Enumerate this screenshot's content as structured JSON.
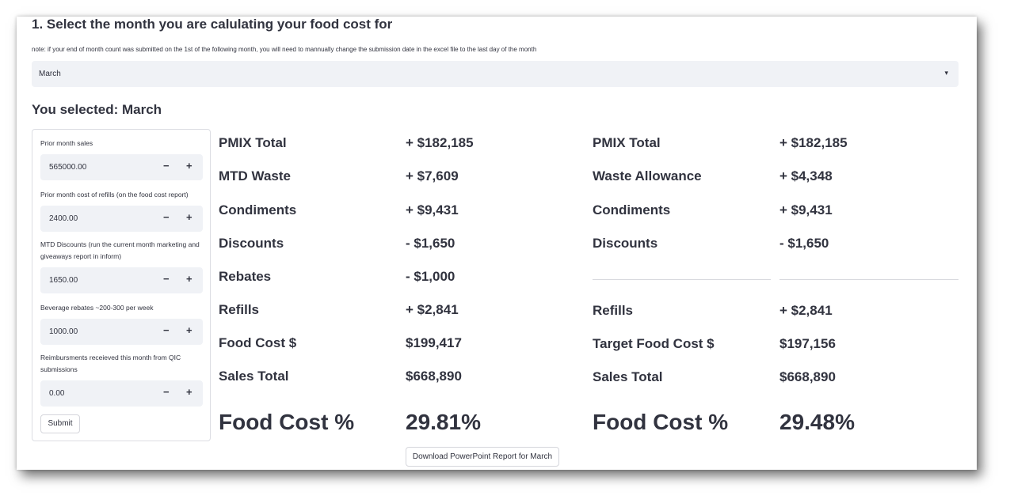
{
  "step_title": "1. Select the month you are calulating your food cost for",
  "note": "note: if your end of month count was submitted on the 1st of the following month, you will need to mannually change the submission date in the excel file to the last day of the month",
  "month_select": {
    "value": "March",
    "caret": "▾"
  },
  "selected_heading": "You selected: March",
  "form": {
    "fields": [
      {
        "label": "Prior month sales",
        "value": "565000.00"
      },
      {
        "label": "Prior month cost of refills (on the food cost report)",
        "value": "2400.00"
      },
      {
        "label": "MTD Discounts (run the current month marketing and giveaways report in inform)",
        "value": "1650.00"
      },
      {
        "label": "Beverage rebates ~200-300 per week",
        "value": "1000.00"
      },
      {
        "label": "Reimbursments receieved this month from QIC submissions",
        "value": "0.00"
      }
    ],
    "minus": "−",
    "plus": "+",
    "submit_label": "Submit"
  },
  "actual": [
    {
      "label": "PMIX Total",
      "value": "+ $182,185"
    },
    {
      "label": "MTD Waste",
      "value": "+ $7,609"
    },
    {
      "label": "Condiments",
      "value": "+ $9,431"
    },
    {
      "label": "Discounts",
      "value": "- $1,650"
    },
    {
      "label": "Rebates",
      "value": "- $1,000"
    },
    {
      "label": "Refills",
      "value": "+ $2,841"
    },
    {
      "label": "Food Cost $",
      "value": "$199,417"
    },
    {
      "label": "Sales Total",
      "value": "$668,890"
    },
    {
      "label": "Food Cost %",
      "value": "29.81%"
    }
  ],
  "target": [
    {
      "label": "PMIX Total",
      "value": "+ $182,185"
    },
    {
      "label": "Waste Allowance",
      "value": "+ $4,348"
    },
    {
      "label": "Condiments",
      "value": "+ $9,431"
    },
    {
      "label": "Discounts",
      "value": "- $1,650"
    },
    {
      "label": "Refills",
      "value": "+ $2,841"
    },
    {
      "label": "Target Food Cost $",
      "value": "$197,156"
    },
    {
      "label": "Sales Total",
      "value": "$668,890"
    },
    {
      "label": "Food Cost %",
      "value": "29.48%"
    }
  ],
  "download_label": "Download PowerPoint Report for March"
}
